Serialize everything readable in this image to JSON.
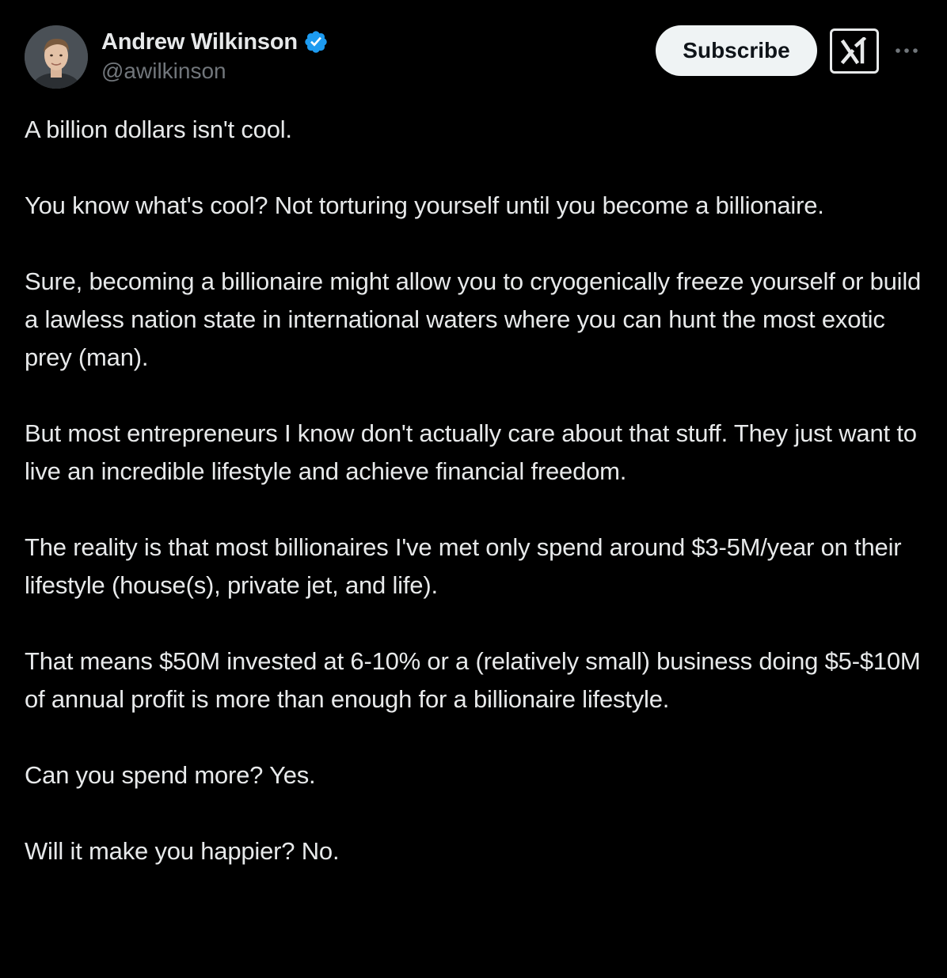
{
  "author": {
    "display_name": "Andrew Wilkinson",
    "handle": "@awilkinson",
    "verified": true,
    "verified_color": "#1d9bf0"
  },
  "actions": {
    "subscribe_label": "Subscribe",
    "grok_icon": "grok-icon",
    "more_icon": "more-horizontal-icon"
  },
  "tweet": {
    "paragraphs": [
      "A billion dollars isn't cool.",
      "You know what's cool? Not torturing yourself until you become a billionaire.",
      "Sure, becoming a billionaire might allow you to cryogenically freeze yourself or build a lawless nation state in international waters where you can hunt the most exotic prey (man).",
      "But most entrepreneurs I know don't actually care about that stuff. They just want to live an incredible lifestyle and achieve financial freedom.",
      "The reality is that most billionaires I've met only spend around $3-5M/year on their lifestyle (house(s), private jet, and life).",
      "That means $50M invested at 6-10% or a (relatively small) business doing $5-$10M of annual profit is more than enough for a billionaire lifestyle.",
      "Can you spend more? Yes.",
      "Will it make you happier? No."
    ]
  },
  "colors": {
    "background": "#000000",
    "text_primary": "#e7e9ea",
    "text_secondary": "#71767b",
    "button_bg": "#eff3f4"
  }
}
